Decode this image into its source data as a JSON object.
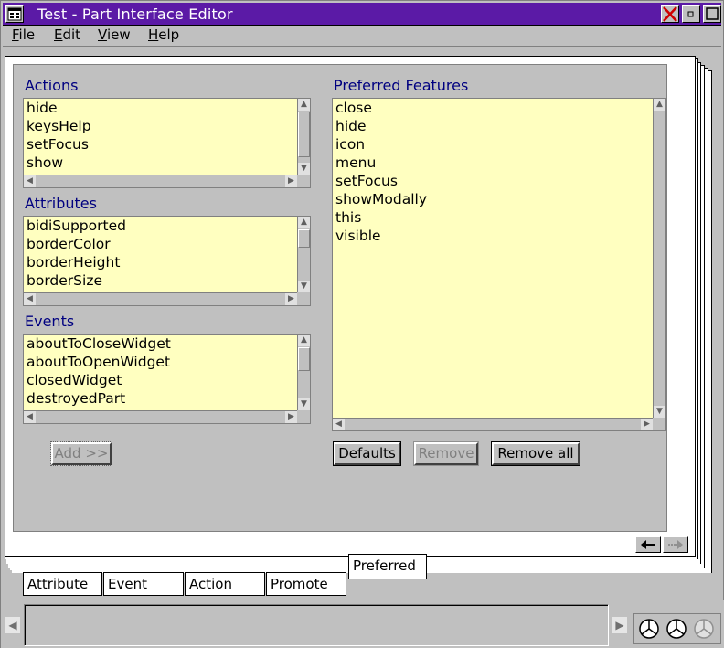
{
  "window": {
    "title": "Test - Part Interface Editor"
  },
  "menubar": {
    "items": [
      {
        "label": "File",
        "mnemonic": "F",
        "rest": "ile"
      },
      {
        "label": "Edit",
        "mnemonic": "E",
        "rest": "dit"
      },
      {
        "label": "View",
        "mnemonic": "V",
        "rest": "iew"
      },
      {
        "label": "Help",
        "mnemonic": "H",
        "rest": "elp"
      }
    ]
  },
  "left": {
    "actions": {
      "label": "Actions",
      "items": [
        "hide",
        "keysHelp",
        "setFocus",
        "show"
      ]
    },
    "attributes": {
      "label": "Attributes",
      "items": [
        "bidiSupported",
        "borderColor",
        "borderHeight",
        "borderSize"
      ]
    },
    "events": {
      "label": "Events",
      "items": [
        "aboutToCloseWidget",
        "aboutToOpenWidget",
        "closedWidget",
        "destroyedPart"
      ]
    },
    "add_button": "Add >>"
  },
  "right": {
    "preferred": {
      "label": "Preferred Features",
      "items": [
        "close",
        "hide",
        "icon",
        "menu",
        "setFocus",
        "showModally",
        "this",
        "visible"
      ]
    },
    "buttons": {
      "defaults": "Defaults",
      "remove": "Remove",
      "remove_all": "Remove all"
    }
  },
  "tabs": [
    {
      "label": "Attribute"
    },
    {
      "label": "Event"
    },
    {
      "label": "Action"
    },
    {
      "label": "Promote"
    },
    {
      "label": "Preferred"
    }
  ],
  "colors": {
    "titlebar": "#5b1aa6",
    "list_bg": "#ffffc0",
    "group_label": "#000080"
  }
}
